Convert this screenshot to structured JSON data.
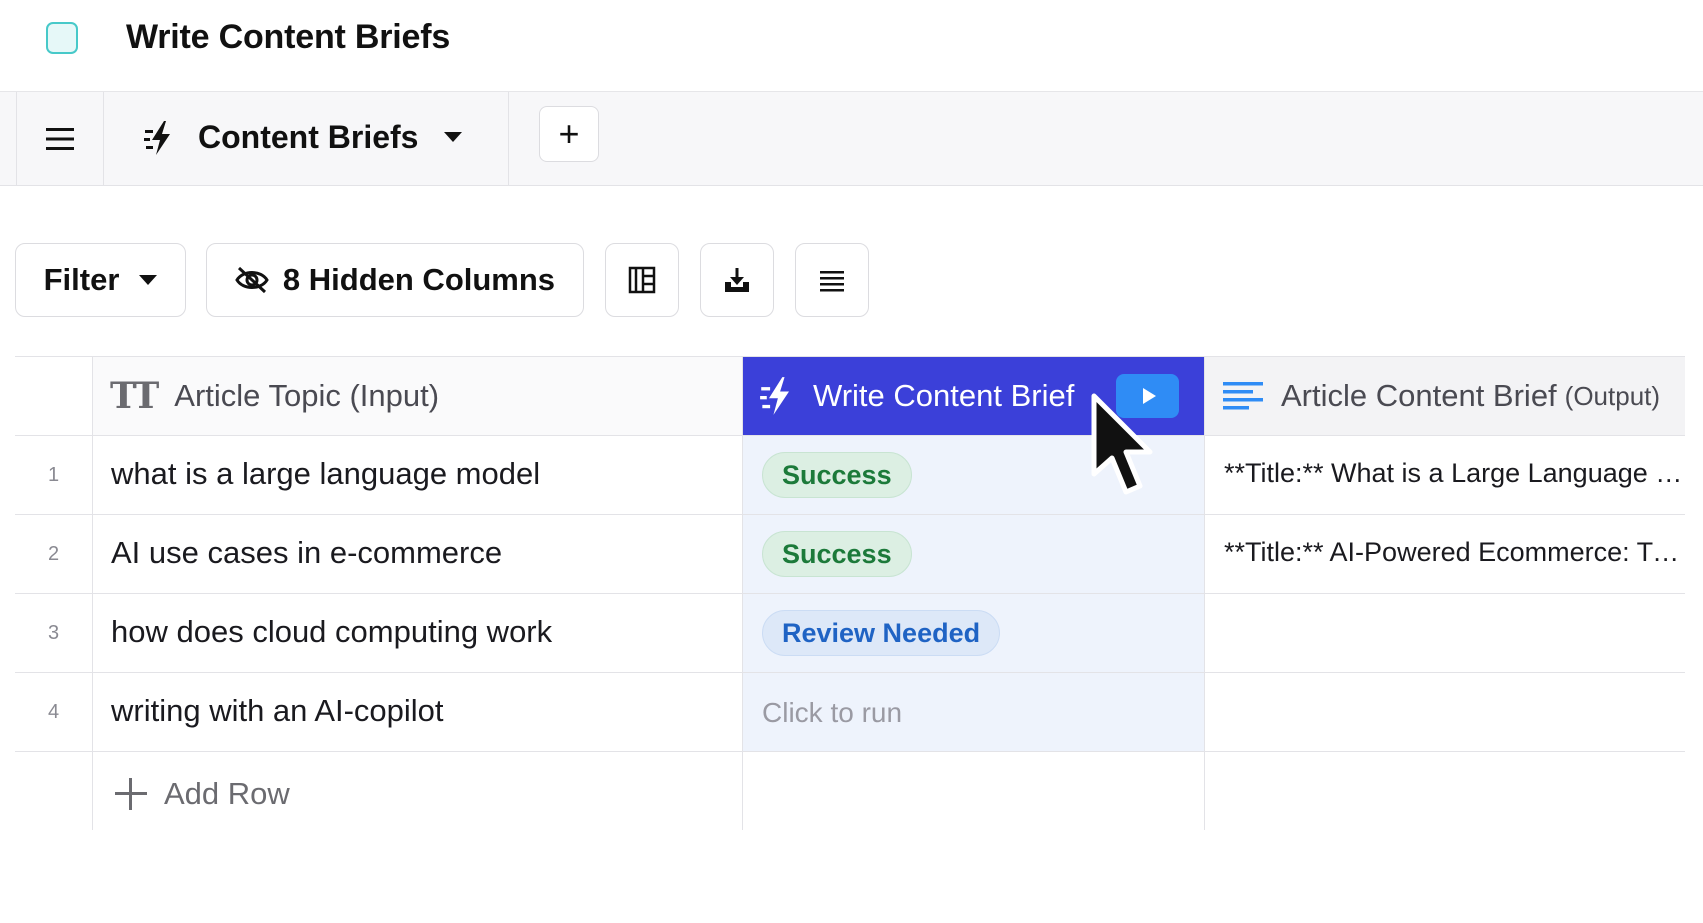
{
  "window": {
    "title": "Write Content Briefs"
  },
  "tabs": {
    "active_tab_label": "Content Briefs",
    "add_tab_label": "+"
  },
  "toolbar": {
    "filter_label": "Filter",
    "hidden_columns_label": "8 Hidden Columns"
  },
  "table": {
    "columns": [
      {
        "label": "Article Topic (Input)",
        "icon": "text-type-icon"
      },
      {
        "label": "Write Content Brief",
        "icon": "lightning-icon"
      },
      {
        "label": "Article Content Brief",
        "sublabel": "(Output)",
        "icon": "paragraph-icon"
      }
    ],
    "rows": [
      {
        "num": "1",
        "topic": "what is a large language model",
        "status": "Success",
        "output": "**Title:** What is a Large Language Model"
      },
      {
        "num": "2",
        "topic": "AI use cases in e-commerce",
        "status": "Success",
        "output": "**Title:** AI-Powered Ecommerce: Transforming Online Retail"
      },
      {
        "num": "3",
        "topic": "how does cloud computing work",
        "status": "Review Needed",
        "output": ""
      },
      {
        "num": "4",
        "topic": "writing with an AI-copilot",
        "status": "Click to run",
        "output": ""
      }
    ],
    "add_row_label": "Add Row"
  },
  "colors": {
    "accent": "#3b40d9",
    "run_button": "#2f8cf5",
    "success_bg": "#dcefe3",
    "success_text": "#1c7a3a",
    "review_bg": "#dde8f8",
    "review_text": "#1f63c4",
    "run_column_bg": "#eef3fc"
  }
}
